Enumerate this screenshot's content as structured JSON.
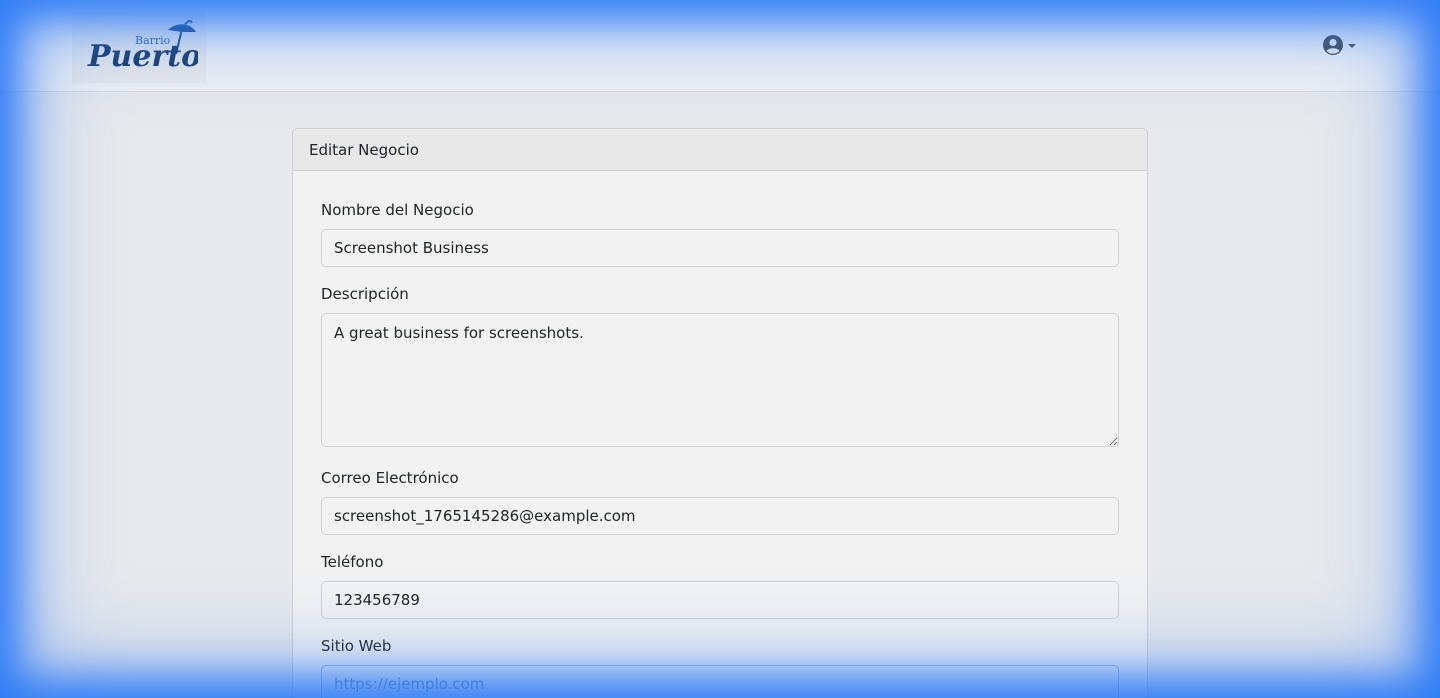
{
  "brand": {
    "logo_text_small": "Barrio",
    "logo_text_large": "Puerto"
  },
  "header": {
    "user_icon": "user-circle-icon",
    "dropdown_icon": "caret-down-icon"
  },
  "card": {
    "title": "Editar Negocio"
  },
  "form": {
    "name_label": "Nombre del Negocio",
    "name_value": "Screenshot Business",
    "description_label": "Descripción",
    "description_value": "A great business for screenshots.",
    "email_label": "Correo Electrónico",
    "email_value": "screenshot_1765145286@example.com",
    "phone_label": "Teléfono",
    "phone_value": "123456789",
    "website_label": "Sitio Web",
    "website_value": "",
    "website_placeholder": "https://ejemplo.com"
  },
  "colors": {
    "frame_glow": "#2f7cf6",
    "logo_blue": "#1d4f86"
  }
}
